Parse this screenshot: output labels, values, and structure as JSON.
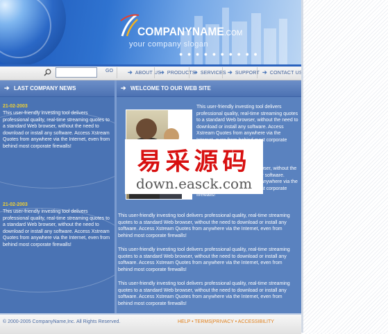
{
  "header": {
    "company_name": "COMPANYNAME",
    "company_tld": ".COM",
    "slogan": "your company slogan"
  },
  "search": {
    "value": "",
    "go_label": "GO"
  },
  "nav": {
    "items": [
      {
        "label": "ABOUT US"
      },
      {
        "label": "PRODUCTS"
      },
      {
        "label": "SERVICES"
      },
      {
        "label": "SUPPORT"
      },
      {
        "label": "CONTACT US"
      }
    ]
  },
  "left": {
    "title": "LAST COMPANY NEWS",
    "news": [
      {
        "date": "21-02-2003",
        "text": "This user-friendly investing tool delivers professional quality, real-time streaming quotes to a standard Web browser, without the need to download or install any software. Access Xstream Quotes from anywhere via the Internet, even from behind most corporate firewalls!"
      },
      {
        "date": "21-02-2003",
        "text": " This user-friendly investing tool delivers professional quality, real-time streaming quotes to a standard Web browser, without the need to download or install any software. Access Xstream Quotes from anywhere via the Internet, even from behind most corporate firewalls!"
      }
    ]
  },
  "main": {
    "title": "WELCOME TO OUR WEB SITE",
    "intro_top": "This user-friendly investing tool delivers professional quality, real-time streaming quotes to a standard Web browser, without the need to download or install any software. Access Xstream Quotes from anywhere via the Internet, even from behind most corporate firewalls!",
    "intro_bottom": "quotes to a standard Web browser, without the need to download or install any software. Access Xstream Quotes from anywhere via the Internet, even from behind most corporate firewalls!",
    "paragraphs": [
      "This user-friendly investing tool delivers professional quality, real-time streaming quotes to a standard Web browser, without the need to download or install any software. Access Xstream Quotes from anywhere via the Internet, even from behind most corporate firewalls!",
      "This user-friendly investing tool delivers professional quality, real-time streaming quotes to a standard Web browser, without the need to download or install any software. Access Xstream Quotes from anywhere via the Internet, even from behind most corporate firewalls!",
      "This user-friendly investing tool delivers professional quality, real-time streaming quotes to a standard Web browser, without the need to download or install any software. Access Xstream Quotes from anywhere via the Internet, even from behind most corporate firewalls!"
    ]
  },
  "watermark": {
    "chinese": "易采源码",
    "url": "down.easck.com"
  },
  "footer": {
    "copyright": "© 2000-2005 CompanyName,Inc. All Rights Reserved.",
    "links": [
      {
        "label": "HELP"
      },
      {
        "label": "TERMS"
      },
      {
        "label": "PRIVACY"
      },
      {
        "label": "ACCESSIBILITY"
      }
    ]
  },
  "colors": {
    "page_blue": "#4d78b5",
    "news_date": "#f2d230",
    "footer_links": "#e07f1a",
    "watermark_red": "#d81010"
  },
  "icons": {
    "search": "magnifier-icon",
    "nav_arrow": "arrow-right-icon",
    "section_arrow": "arrow-right-icon"
  }
}
